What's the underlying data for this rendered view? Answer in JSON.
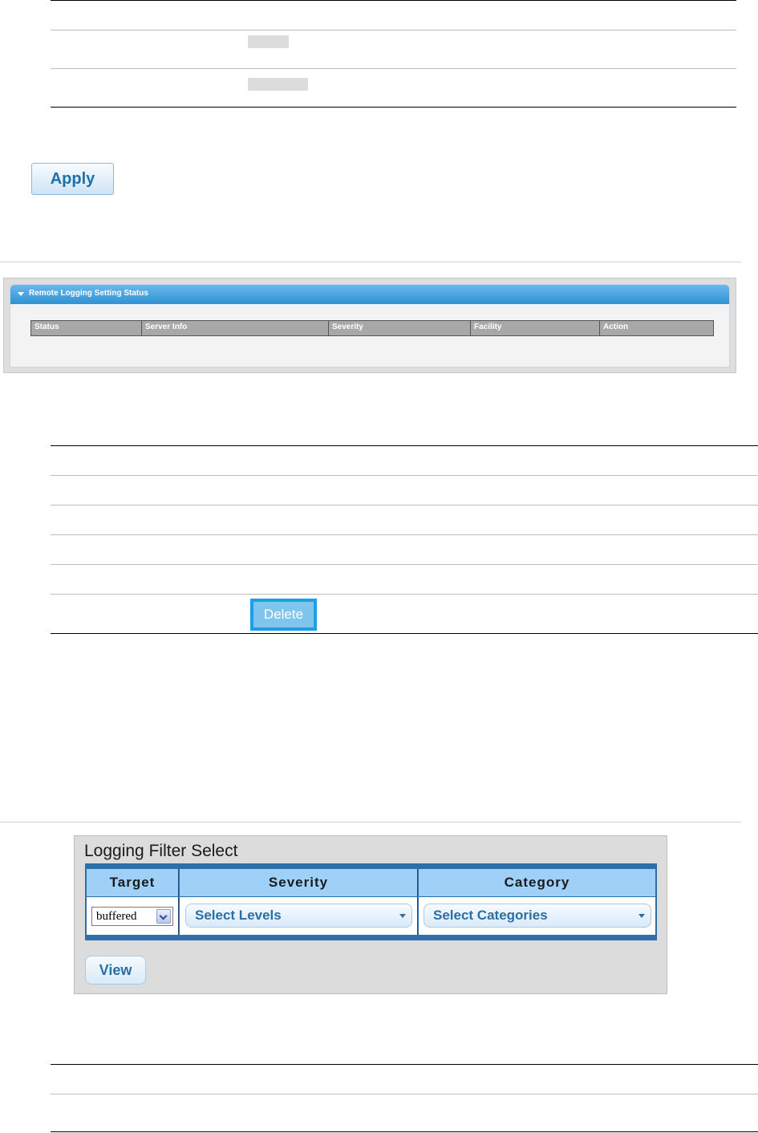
{
  "top_table": {
    "apply_label": "Apply"
  },
  "remote_logging": {
    "title": "Remote Logging Setting Status",
    "columns": [
      "Status",
      "Server Info",
      "Severity",
      "Facility",
      "Action"
    ]
  },
  "middle_table": {
    "delete_label": "Delete"
  },
  "logging_filter": {
    "title": "Logging Filter Select",
    "columns": [
      "Target",
      "Severity",
      "Category"
    ],
    "target_value": "buffered",
    "severity_value": "Select Levels",
    "category_value": "Select Categories",
    "view_label": "View"
  }
}
